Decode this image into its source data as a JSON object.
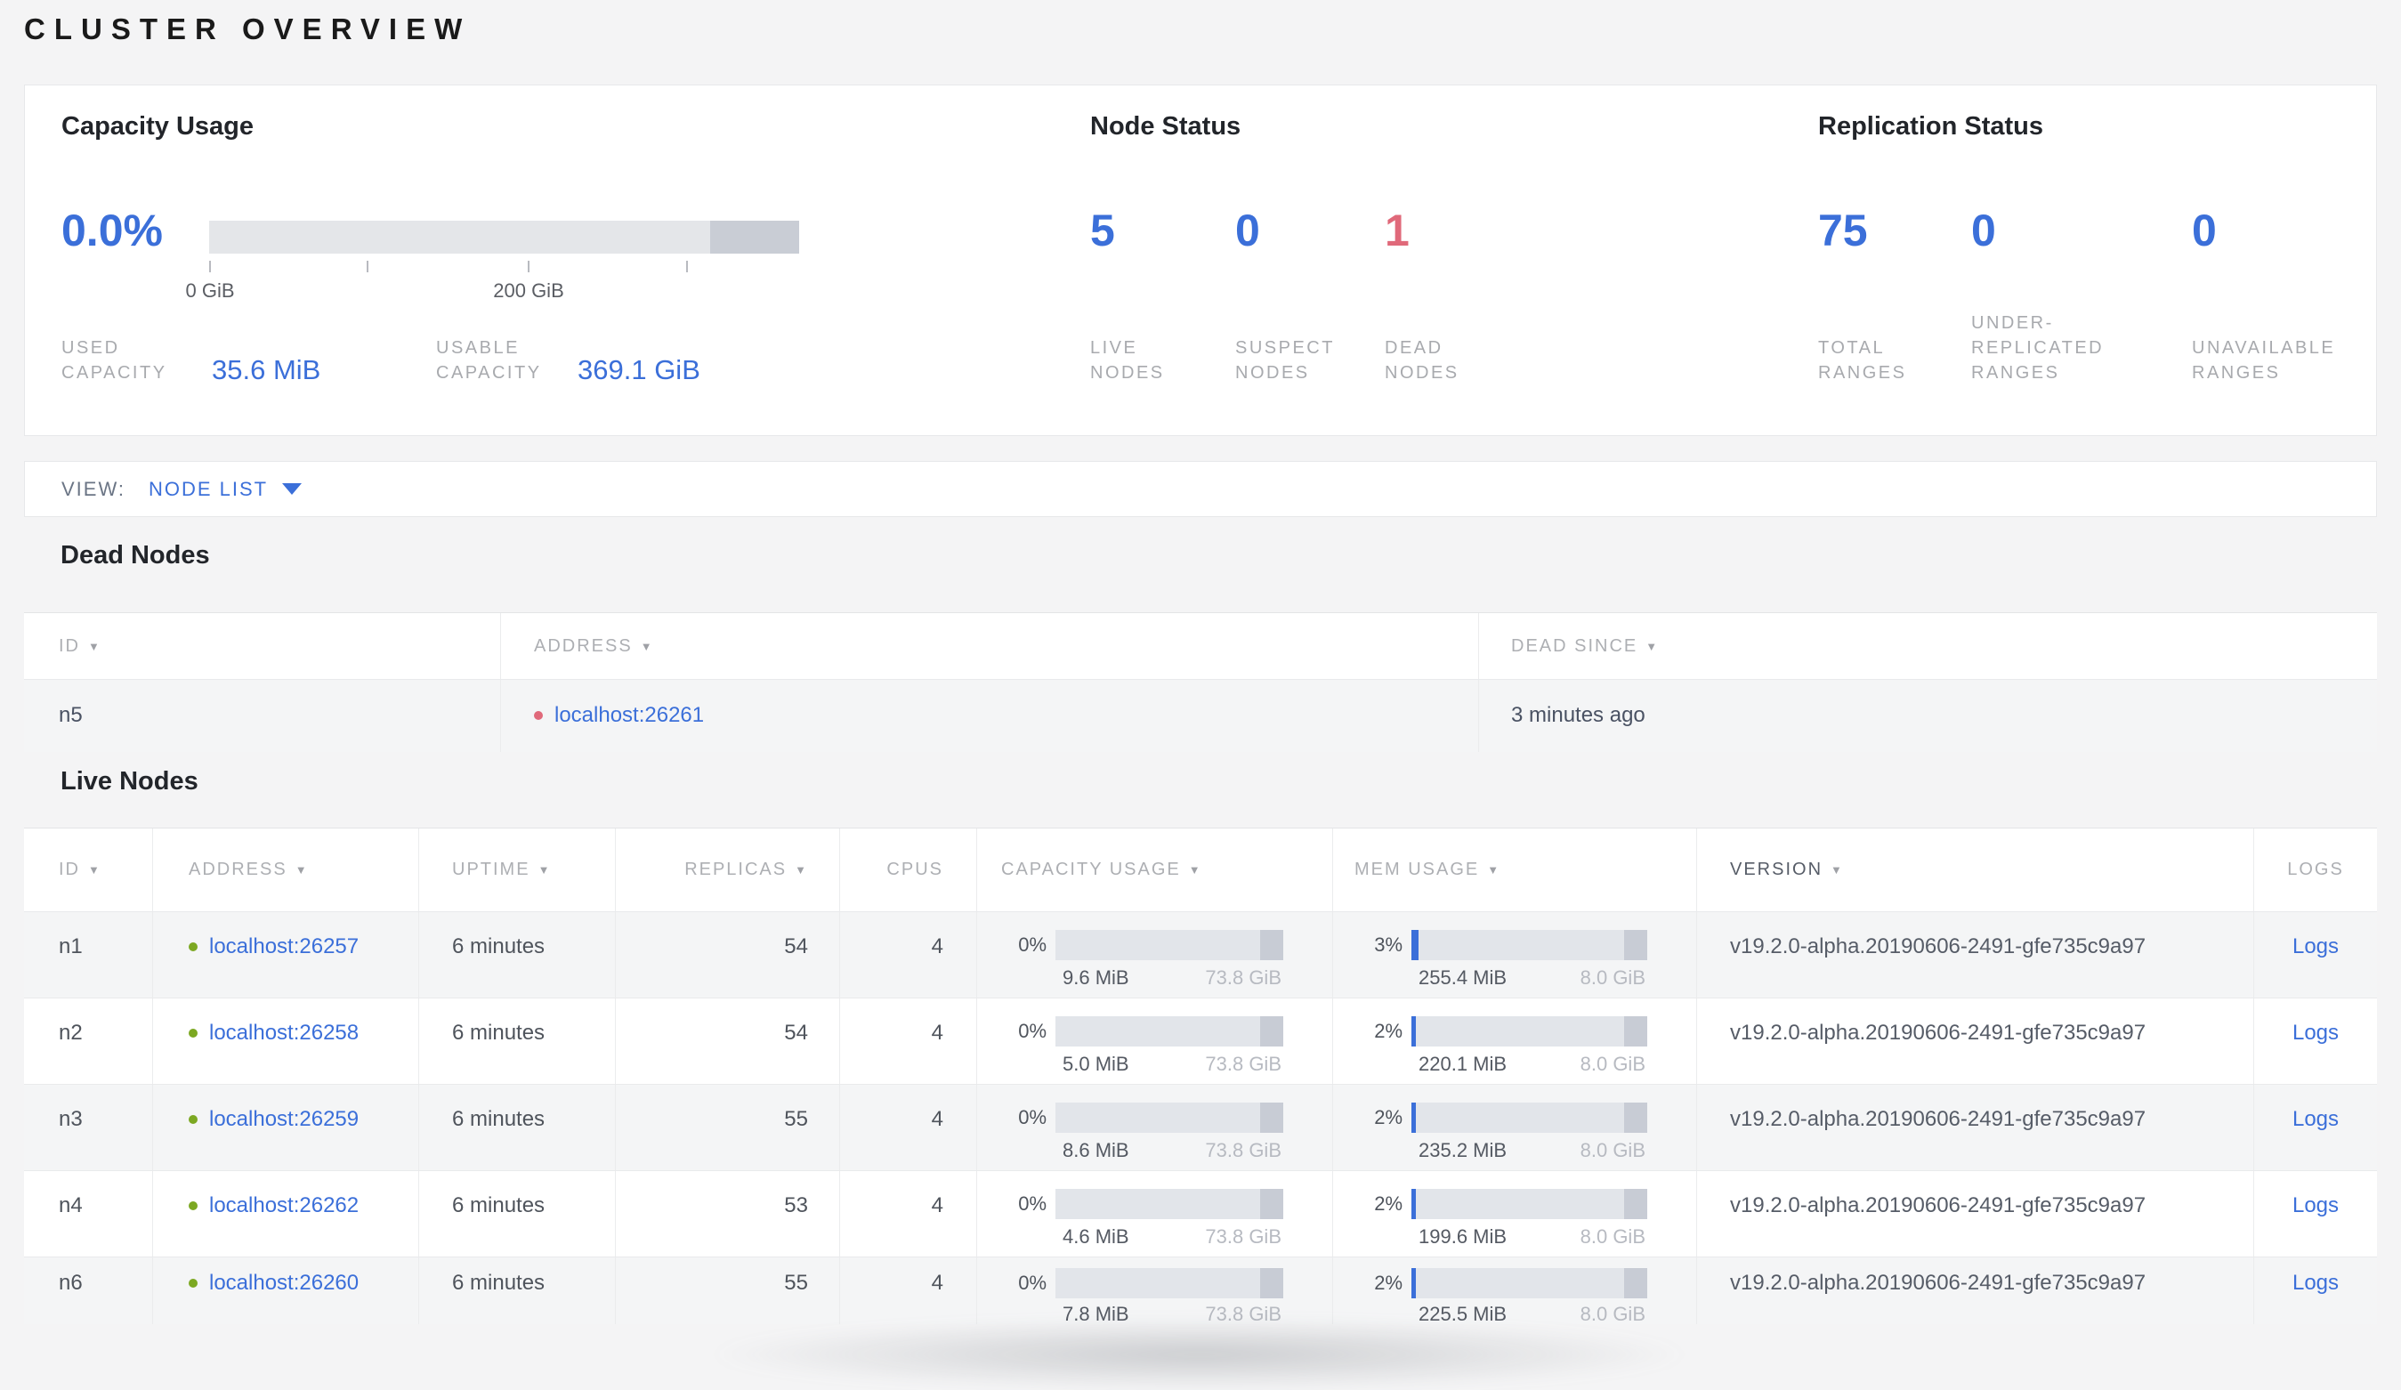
{
  "page_title": "CLUSTER OVERVIEW",
  "colors": {
    "accent_blue": "#3b6fd9",
    "danger_red": "#e0697a",
    "live_dot_green": "#7ca822",
    "dead_dot_red": "#e0697a"
  },
  "summary": {
    "capacity": {
      "title": "Capacity Usage",
      "percent": "0.0%",
      "used_fill_pct": 0,
      "tick_labels": {
        "first": "0 GiB",
        "third": "200 GiB"
      },
      "used": {
        "label": "USED\nCAPACITY",
        "value": "35.6 MiB"
      },
      "usable": {
        "label": "USABLE\nCAPACITY",
        "value": "369.1 GiB"
      }
    },
    "node_status": {
      "title": "Node Status",
      "items": [
        {
          "value": "5",
          "label": "LIVE\nNODES",
          "tone": "blue"
        },
        {
          "value": "0",
          "label": "SUSPECT\nNODES",
          "tone": "blue"
        },
        {
          "value": "1",
          "label": "DEAD\nNODES",
          "tone": "red"
        }
      ]
    },
    "replication": {
      "title": "Replication Status",
      "items": [
        {
          "value": "75",
          "label": "TOTAL\nRANGES",
          "tone": "blue"
        },
        {
          "value": "0",
          "label": "UNDER-\nREPLICATED\nRANGES",
          "tone": "blue"
        },
        {
          "value": "0",
          "label": "UNAVAILABLE\nRANGES",
          "tone": "blue"
        }
      ]
    }
  },
  "view_bar": {
    "label": "VIEW:",
    "selected": "NODE LIST"
  },
  "dead_nodes": {
    "title": "Dead Nodes",
    "columns": [
      {
        "label": "ID",
        "sortable": true
      },
      {
        "label": "ADDRESS",
        "sortable": true
      },
      {
        "label": "DEAD SINCE",
        "sortable": true
      }
    ],
    "rows": [
      {
        "id": "n5",
        "address": "localhost:26261",
        "status": "dead",
        "dead_since": "3 minutes ago"
      }
    ]
  },
  "live_nodes": {
    "title": "Live Nodes",
    "columns": [
      {
        "label": "ID",
        "sortable": true
      },
      {
        "label": "ADDRESS",
        "sortable": true
      },
      {
        "label": "UPTIME",
        "sortable": true
      },
      {
        "label": "REPLICAS",
        "sortable": true
      },
      {
        "label": "CPUS",
        "sortable": false
      },
      {
        "label": "CAPACITY USAGE",
        "sortable": true
      },
      {
        "label": "MEM USAGE",
        "sortable": true
      },
      {
        "label": "VERSION",
        "sortable": true
      },
      {
        "label": "LOGS",
        "sortable": false
      }
    ],
    "logs_label": "Logs",
    "rows": [
      {
        "id": "n1",
        "address": "localhost:26257",
        "status": "live",
        "uptime": "6 minutes",
        "replicas": "54",
        "cpus": "4",
        "capacity": {
          "percent": "0%",
          "fill_pct": 0,
          "used": "9.6 MiB",
          "total": "73.8 GiB"
        },
        "memory": {
          "percent": "3%",
          "fill_pct": 3,
          "used": "255.4 MiB",
          "total": "8.0 GiB"
        },
        "version": "v19.2.0-alpha.20190606-2491-gfe735c9a97"
      },
      {
        "id": "n2",
        "address": "localhost:26258",
        "status": "live",
        "uptime": "6 minutes",
        "replicas": "54",
        "cpus": "4",
        "capacity": {
          "percent": "0%",
          "fill_pct": 0,
          "used": "5.0 MiB",
          "total": "73.8 GiB"
        },
        "memory": {
          "percent": "2%",
          "fill_pct": 2,
          "used": "220.1 MiB",
          "total": "8.0 GiB"
        },
        "version": "v19.2.0-alpha.20190606-2491-gfe735c9a97"
      },
      {
        "id": "n3",
        "address": "localhost:26259",
        "status": "live",
        "uptime": "6 minutes",
        "replicas": "55",
        "cpus": "4",
        "capacity": {
          "percent": "0%",
          "fill_pct": 0,
          "used": "8.6 MiB",
          "total": "73.8 GiB"
        },
        "memory": {
          "percent": "2%",
          "fill_pct": 2,
          "used": "235.2 MiB",
          "total": "8.0 GiB"
        },
        "version": "v19.2.0-alpha.20190606-2491-gfe735c9a97"
      },
      {
        "id": "n4",
        "address": "localhost:26262",
        "status": "live",
        "uptime": "6 minutes",
        "replicas": "53",
        "cpus": "4",
        "capacity": {
          "percent": "0%",
          "fill_pct": 0,
          "used": "4.6 MiB",
          "total": "73.8 GiB"
        },
        "memory": {
          "percent": "2%",
          "fill_pct": 2,
          "used": "199.6 MiB",
          "total": "8.0 GiB"
        },
        "version": "v19.2.0-alpha.20190606-2491-gfe735c9a97"
      },
      {
        "id": "n6",
        "address": "localhost:26260",
        "status": "live",
        "uptime": "6 minutes",
        "replicas": "55",
        "cpus": "4",
        "capacity": {
          "percent": "0%",
          "fill_pct": 0,
          "used": "7.8 MiB",
          "total": "73.8 GiB"
        },
        "memory": {
          "percent": "2%",
          "fill_pct": 2,
          "used": "225.5 MiB",
          "total": "8.0 GiB"
        },
        "version": "v19.2.0-alpha.20190606-2491-gfe735c9a97"
      }
    ]
  }
}
